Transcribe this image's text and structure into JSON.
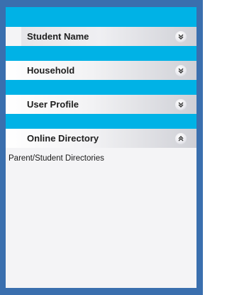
{
  "colors": {
    "border": "#3a6fae",
    "accent": "#00b2e6",
    "panel": "#f4f4f6"
  },
  "sections": [
    {
      "label": "Student Name",
      "state": "collapsed",
      "icon": "chevron-double-down-icon"
    },
    {
      "label": "Household",
      "state": "collapsed",
      "icon": "chevron-double-down-icon"
    },
    {
      "label": "User Profile",
      "state": "collapsed",
      "icon": "chevron-double-down-icon"
    },
    {
      "label": "Online Directory",
      "state": "expanded",
      "icon": "chevron-double-up-icon",
      "items": [
        "Parent/Student Directories"
      ]
    }
  ]
}
